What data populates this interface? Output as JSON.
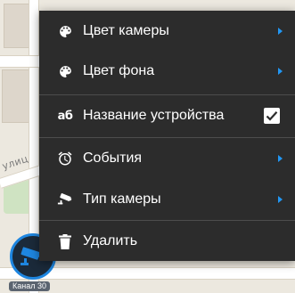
{
  "menu": {
    "items": [
      {
        "label": "Цвет камеры",
        "icon": "palette-icon",
        "has_submenu": true
      },
      {
        "label": "Цвет фона",
        "icon": "palette-icon",
        "has_submenu": true
      },
      {
        "label": "Название устройства",
        "icon": "text-format-icon",
        "icon_text": "аб",
        "checked": true
      },
      {
        "label": "События",
        "icon": "alarm-clock-icon",
        "has_submenu": true
      },
      {
        "label": "Тип камеры",
        "icon": "cctv-camera-icon",
        "has_submenu": true
      },
      {
        "label": "Удалить",
        "icon": "trash-icon"
      }
    ]
  },
  "map": {
    "street_label": "улиц"
  },
  "marker": {
    "label": "Канал 30"
  },
  "colors": {
    "menu_background": "#2c2c2c",
    "menu_text": "#ffffff",
    "submenu_arrow": "#2196f3",
    "marker_ring": "#1e86e0",
    "map_background": "#ece8df"
  }
}
